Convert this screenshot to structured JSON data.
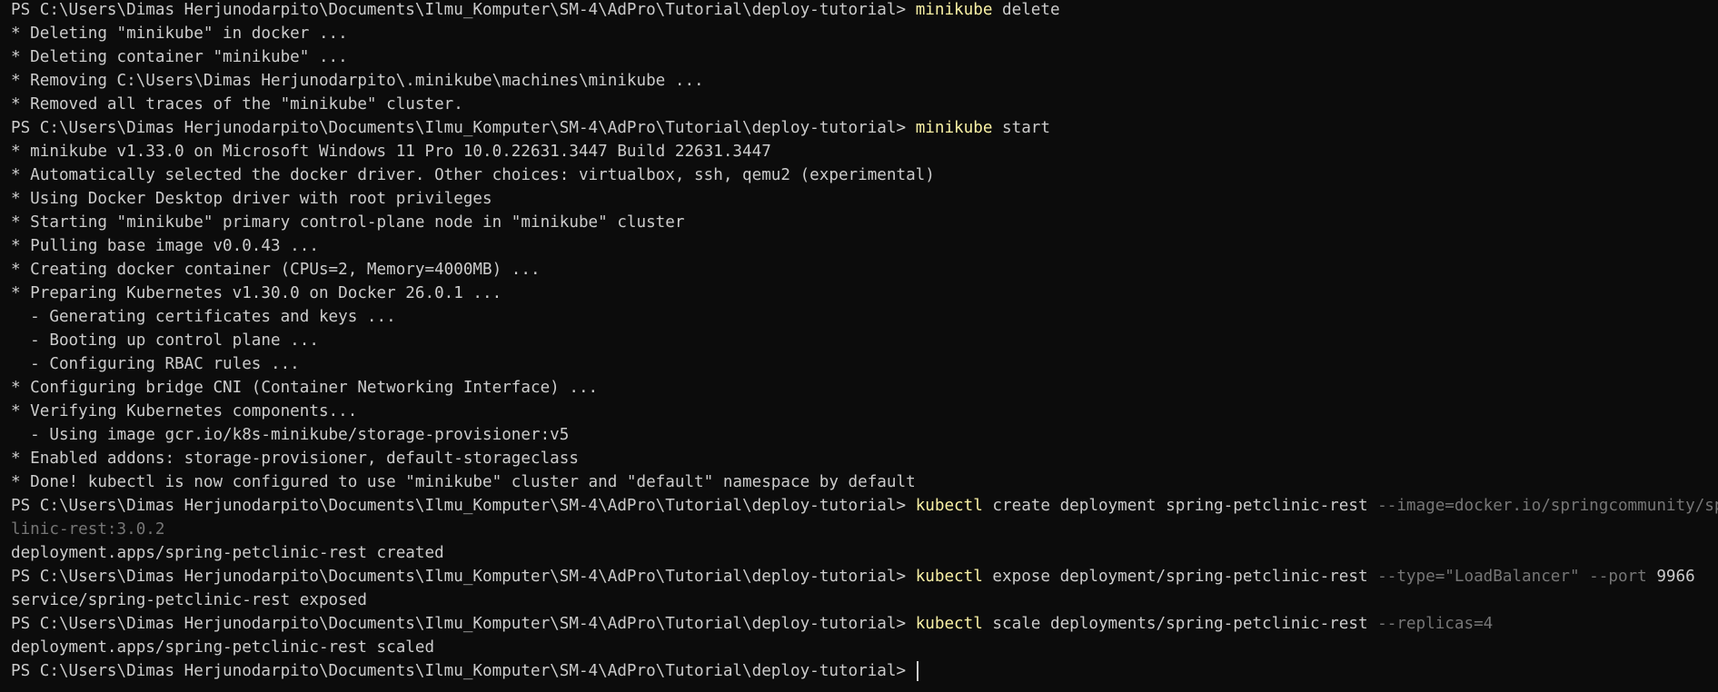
{
  "terminal": {
    "prompt": "PS C:\\Users\\Dimas Herjunodarpito\\Documents\\Ilmu_Komputer\\SM-4\\AdPro\\Tutorial\\deploy-tutorial> ",
    "lines": [
      {
        "type": "cmd",
        "cmd": "minikube",
        "arg": " delete"
      },
      {
        "type": "out",
        "text": "* Deleting \"minikube\" in docker ..."
      },
      {
        "type": "out",
        "text": "* Deleting container \"minikube\" ..."
      },
      {
        "type": "out",
        "text": "* Removing C:\\Users\\Dimas Herjunodarpito\\.minikube\\machines\\minikube ..."
      },
      {
        "type": "out",
        "text": "* Removed all traces of the \"minikube\" cluster."
      },
      {
        "type": "cmd",
        "cmd": "minikube",
        "arg": " start"
      },
      {
        "type": "out",
        "text": "* minikube v1.33.0 on Microsoft Windows 11 Pro 10.0.22631.3447 Build 22631.3447"
      },
      {
        "type": "out",
        "text": "* Automatically selected the docker driver. Other choices: virtualbox, ssh, qemu2 (experimental)"
      },
      {
        "type": "out",
        "text": "* Using Docker Desktop driver with root privileges"
      },
      {
        "type": "out",
        "text": "* Starting \"minikube\" primary control-plane node in \"minikube\" cluster"
      },
      {
        "type": "out",
        "text": "* Pulling base image v0.0.43 ..."
      },
      {
        "type": "out",
        "text": "* Creating docker container (CPUs=2, Memory=4000MB) ..."
      },
      {
        "type": "out",
        "text": "* Preparing Kubernetes v1.30.0 on Docker 26.0.1 ..."
      },
      {
        "type": "out",
        "text": "  - Generating certificates and keys ..."
      },
      {
        "type": "out",
        "text": "  - Booting up control plane ..."
      },
      {
        "type": "out",
        "text": "  - Configuring RBAC rules ..."
      },
      {
        "type": "out",
        "text": "* Configuring bridge CNI (Container Networking Interface) ..."
      },
      {
        "type": "out",
        "text": "* Verifying Kubernetes components..."
      },
      {
        "type": "out",
        "text": "  - Using image gcr.io/k8s-minikube/storage-provisioner:v5"
      },
      {
        "type": "out",
        "text": "* Enabled addons: storage-provisioner, default-storageclass"
      },
      {
        "type": "out",
        "text": "* Done! kubectl is now configured to use \"minikube\" cluster and \"default\" namespace by default"
      },
      {
        "type": "cmd",
        "cmd": "kubectl",
        "arg": " create deployment spring-petclinic-rest ",
        "param": "--image=docker.io/springcommunity/spring-petc"
      },
      {
        "type": "dim",
        "text": "linic-rest:3.0.2"
      },
      {
        "type": "out",
        "text": "deployment.apps/spring-petclinic-rest created"
      },
      {
        "type": "cmd",
        "cmd": "kubectl",
        "arg": " expose deployment/spring-petclinic-rest ",
        "param": "--type=\"LoadBalancer\" --port",
        "num": " 9966"
      },
      {
        "type": "out",
        "text": "service/spring-petclinic-rest exposed"
      },
      {
        "type": "cmd",
        "cmd": "kubectl",
        "arg": " scale deployments/spring-petclinic-rest ",
        "param": "--replicas=4"
      },
      {
        "type": "out",
        "text": "deployment.apps/spring-petclinic-rest scaled"
      },
      {
        "type": "prompt"
      }
    ]
  }
}
